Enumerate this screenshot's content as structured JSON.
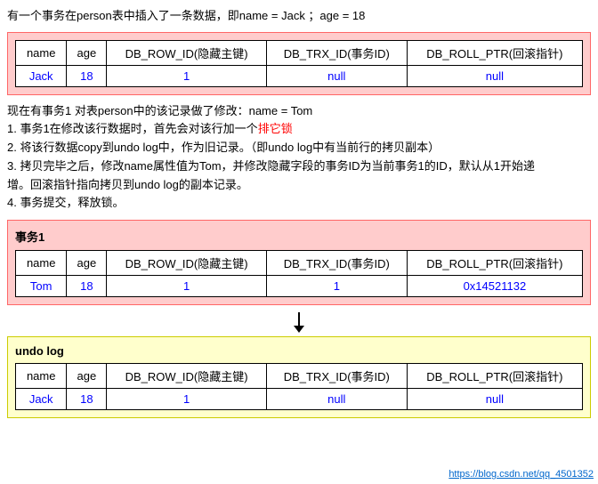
{
  "intro": {
    "text": "有一个事务在person表中插入了一条数据，即name = Jack ；age = 18"
  },
  "initial_table": {
    "headers": [
      "name",
      "age",
      "DB_ROW_ID(隐藏主键)",
      "DB_TRX_ID(事务ID)",
      "DB_ROLL_PTR(回滚指针)"
    ],
    "row": [
      "Jack",
      "18",
      "1",
      "null",
      "null"
    ]
  },
  "description": {
    "intro": "现在有事务1 对表person中的该记录做了修改：name = Tom",
    "lines": [
      {
        "text": "1. 事务1在修改该行数据时，首先会对该行加一个",
        "suffix": "排它锁",
        "rest": ""
      },
      {
        "text": "2. 将该行数据copy到undo log中，作为旧记录。（即undo log中有当前行的拷贝副本）"
      },
      {
        "text": "3. 拷贝完毕之后，修改name属性值为Tom，并修改隐藏字段的事务ID为当前事务1的ID，默认从1开始递"
      },
      {
        "text": "增。回滚指针指向拷贝到undo log的副本记录。"
      },
      {
        "text": "4. 事务提交，释放锁。"
      }
    ]
  },
  "transaction_box": {
    "label": "事务1",
    "headers": [
      "name",
      "age",
      "DB_ROW_ID(隐藏主键)",
      "DB_TRX_ID(事务ID)",
      "DB_ROLL_PTR(回滚指针)"
    ],
    "row": [
      "Tom",
      "18",
      "1",
      "1",
      "0x14521132"
    ]
  },
  "undo_log_box": {
    "label": "undo log",
    "headers": [
      "name",
      "age",
      "DB_ROW_ID(隐藏主键)",
      "DB_TRX_ID(事务ID)",
      "DB_ROLL_PTR(回滚指针)"
    ],
    "row": [
      "Jack",
      "18",
      "1",
      "null",
      "null"
    ]
  },
  "watermark": "https://blog.csdn.net/qq_4501352"
}
